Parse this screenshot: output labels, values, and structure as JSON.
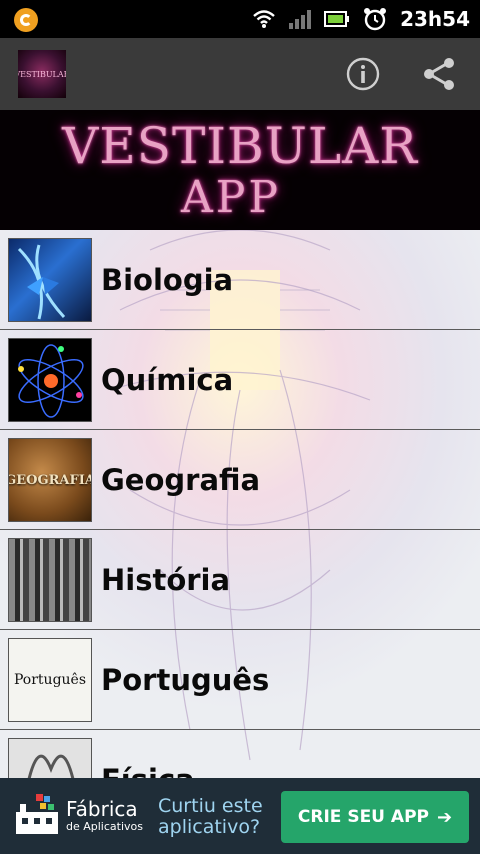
{
  "status_bar": {
    "time": "23h54",
    "icons": [
      "notification-icon",
      "wifi-icon",
      "signal-icon",
      "battery-icon",
      "alarm-icon"
    ]
  },
  "action_bar": {
    "logo_text": "VESTIBULAR",
    "actions": [
      "info-icon",
      "share-icon"
    ]
  },
  "banner": {
    "line1": "VESTIBULAR",
    "line2": "APP"
  },
  "subjects": [
    {
      "label": "Biologia",
      "icon": "biology-thumbnail"
    },
    {
      "label": "Química",
      "icon": "chemistry-thumbnail"
    },
    {
      "label": "Geografia",
      "icon": "geography-thumbnail",
      "thumb_text": "GEOGRAFIA"
    },
    {
      "label": "História",
      "icon": "history-thumbnail"
    },
    {
      "label": "Português",
      "icon": "portuguese-thumbnail",
      "thumb_text": "Português"
    },
    {
      "label": "Física",
      "icon": "physics-thumbnail"
    }
  ],
  "ad": {
    "brand_line1": "Fábrica",
    "brand_line2": "de Aplicativos",
    "prompt": "Curtiu este aplicativo?",
    "cta": "CRIE SEU APP",
    "cta_color": "#25a56a"
  },
  "colors": {
    "status_bar": "#000000",
    "action_bar": "#3a3a3a",
    "banner_text": "#e8a2c4",
    "ad_bar": "#1f2d38"
  }
}
